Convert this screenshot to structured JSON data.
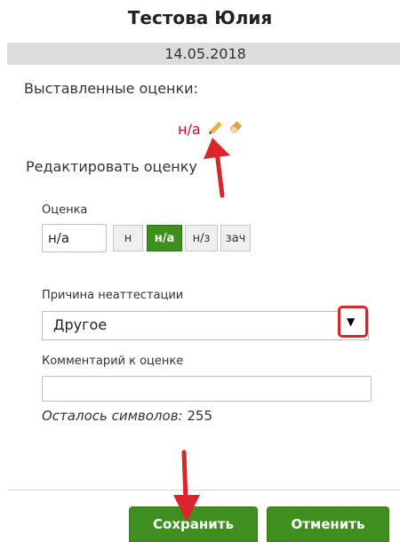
{
  "header": {
    "student_name": "Тестова Юлия",
    "date": "14.05.2018"
  },
  "assigned": {
    "label": "Выставленные оценки:",
    "grade": "н/а"
  },
  "edit": {
    "label": "Редактировать оценку",
    "grade_label": "Оценка",
    "grade_value": "н/а",
    "grade_options": [
      "н",
      "н/а",
      "н/з",
      "зач"
    ],
    "selected_option": "н/а"
  },
  "reason": {
    "label": "Причина неаттестации",
    "selected": "Другое",
    "arrow_glyph": "▼"
  },
  "comment": {
    "label": "Комментарий к оценке",
    "value": "",
    "remaining_label": "Осталось символов:",
    "remaining_count": "255"
  },
  "actions": {
    "save_label": "Сохранить",
    "cancel_label": "Отменить"
  },
  "colors": {
    "accent_green": "#3f8f1f",
    "grade_red": "#c8102e",
    "annotation_red": "#d9262b"
  },
  "icons": [
    "pencil-icon",
    "eraser-icon"
  ]
}
